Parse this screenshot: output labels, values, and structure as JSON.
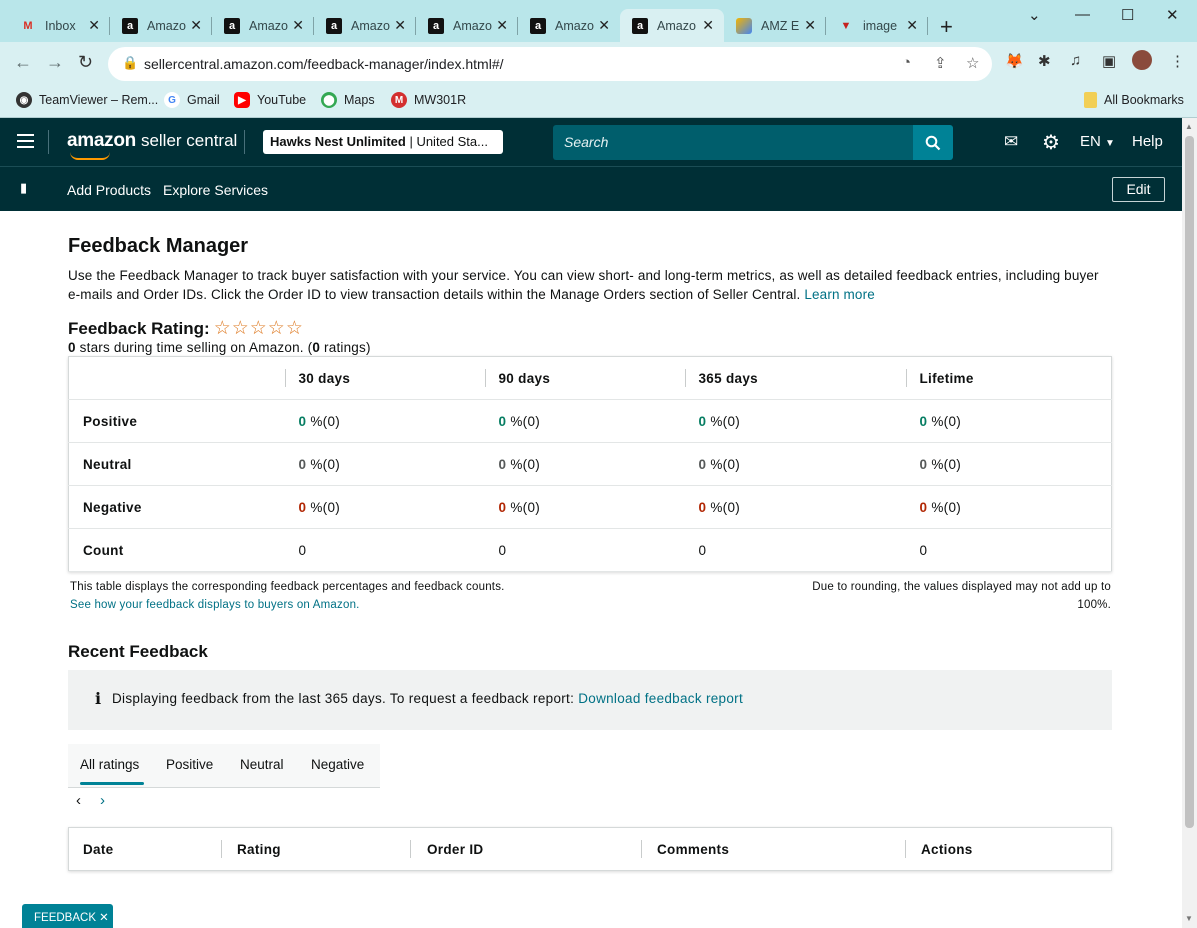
{
  "browser": {
    "tabs": [
      {
        "title": "Inbox",
        "icon": "gmail-icon"
      },
      {
        "title": "Amazo",
        "icon": "amazon-icon"
      },
      {
        "title": "Amazo",
        "icon": "amazon-icon"
      },
      {
        "title": "Amazo",
        "icon": "amazon-icon"
      },
      {
        "title": "Amazo",
        "icon": "amazon-icon"
      },
      {
        "title": "Amazo",
        "icon": "amazon-icon"
      },
      {
        "title": "Amazo",
        "icon": "amazon-icon",
        "active": true
      },
      {
        "title": "AMZ E",
        "icon": "amz-icon"
      },
      {
        "title": "image",
        "icon": "image-icon"
      }
    ],
    "url": "sellercentral.amazon.com/feedback-manager/index.html#/",
    "bookmarks": [
      "TeamViewer – Rem...",
      "Gmail",
      "YouTube",
      "Maps",
      "MW301R"
    ],
    "all_bookmarks": "All Bookmarks"
  },
  "header": {
    "logo_bold": "amazon",
    "logo_text": "seller central",
    "account_name": "Hawks Nest Unlimited",
    "account_region": "United Sta...",
    "search_placeholder": "Search",
    "language": "EN",
    "help": "Help"
  },
  "subnav": {
    "add_products": "Add Products",
    "explore_services": "Explore Services",
    "edit": "Edit"
  },
  "page": {
    "title": "Feedback Manager",
    "description": "Use the Feedback Manager to track buyer satisfaction with your service. You can view short- and long-term metrics, as well as detailed feedback entries, including buyer e-mails and Order IDs. Click the Order ID to view transaction details within the Manage Orders section of Seller Central.",
    "learn_more": "Learn more",
    "rating_title": "Feedback Rating:",
    "stars": "☆☆☆☆☆",
    "rating_stars_value": "0",
    "rating_text_mid": " stars during time selling on Amazon. (",
    "rating_count": "0",
    "rating_text_end": " ratings)"
  },
  "feedback_table": {
    "columns": [
      "30 days",
      "90 days",
      "365 days",
      "Lifetime"
    ],
    "rows": [
      {
        "label": "Positive",
        "values": [
          "0",
          "0",
          "0",
          "0"
        ],
        "suffix": "%(0)"
      },
      {
        "label": "Neutral",
        "values": [
          "0",
          "0",
          "0",
          "0"
        ],
        "suffix": "%(0)"
      },
      {
        "label": "Negative",
        "values": [
          "0",
          "0",
          "0",
          "0"
        ],
        "suffix": "%(0)"
      },
      {
        "label": "Count",
        "values": [
          "0",
          "0",
          "0",
          "0"
        ]
      }
    ],
    "note_left": "This table displays the corresponding feedback percentages and feedback counts.",
    "note_link": "See how your feedback displays to buyers on Amazon.",
    "note_right_1": "Due to rounding, the values displayed may not add up to",
    "note_right_2": "100%."
  },
  "recent": {
    "title": "Recent Feedback",
    "info_text": "Displaying feedback from the last 365 days. To request a feedback report:",
    "info_link": "Download feedback report",
    "tabs": [
      "All ratings",
      "Positive",
      "Neutral",
      "Negative"
    ],
    "columns": [
      "Date",
      "Rating",
      "Order ID",
      "Comments",
      "Actions"
    ]
  },
  "feedback_button": "FEEDBACK ✕"
}
